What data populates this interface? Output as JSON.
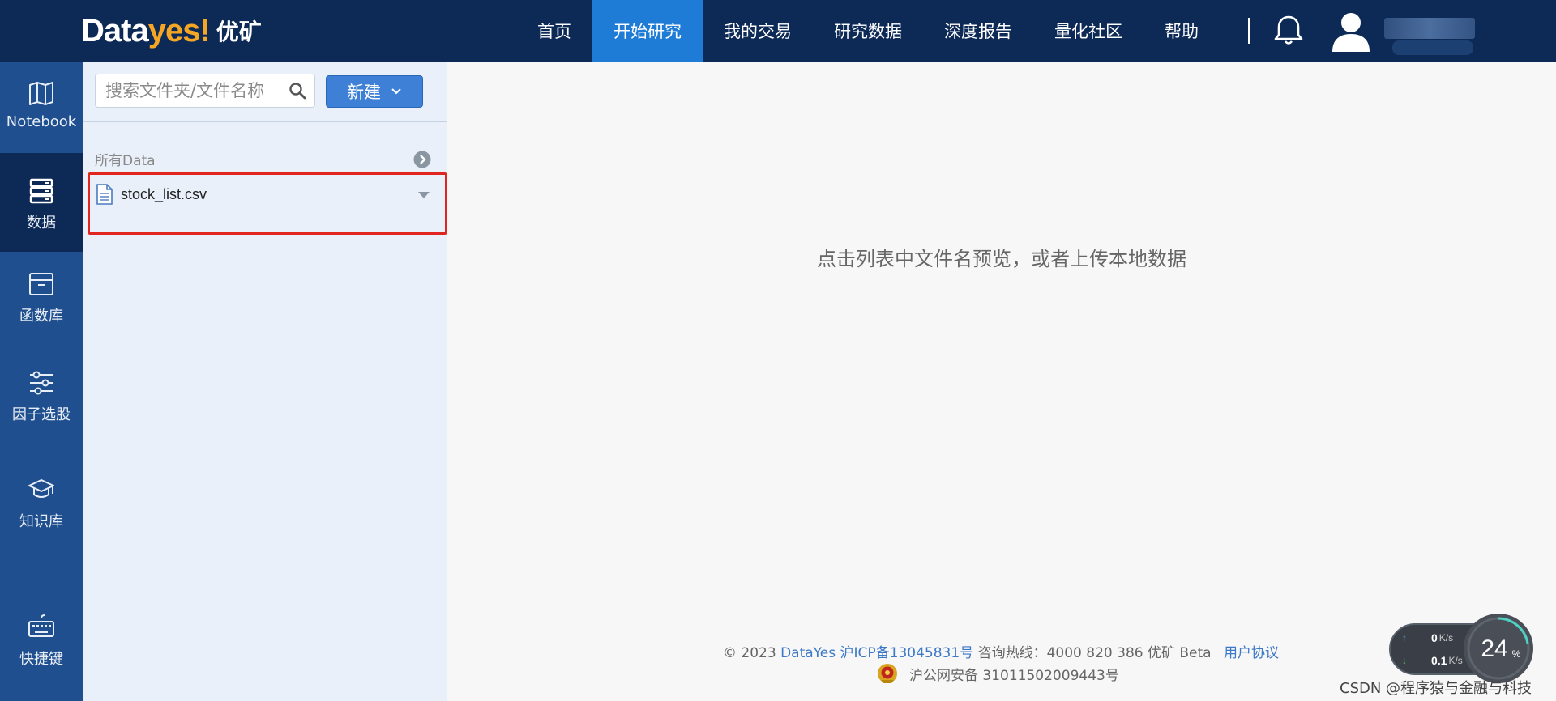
{
  "header": {
    "logo_main": "Data",
    "logo_accent": "yes!",
    "logo_cn": "优矿",
    "nav": [
      {
        "label": "首页"
      },
      {
        "label": "开始研究"
      },
      {
        "label": "我的交易"
      },
      {
        "label": "研究数据"
      },
      {
        "label": "深度报告"
      },
      {
        "label": "量化社区"
      },
      {
        "label": "帮助"
      }
    ],
    "active_nav": "开始研究",
    "icons": [
      "bell-icon",
      "avatar-icon"
    ]
  },
  "sidebar": {
    "items": [
      {
        "label": "Notebook",
        "icon": "book-icon"
      },
      {
        "label": "数据",
        "icon": "database-icon"
      },
      {
        "label": "函数库",
        "icon": "archive-icon"
      },
      {
        "label": "因子选股",
        "icon": "sliders-icon"
      },
      {
        "label": "知识库",
        "icon": "graduation-cap-icon"
      },
      {
        "label": "快捷键",
        "icon": "keyboard-icon"
      }
    ],
    "active": "数据"
  },
  "file_panel": {
    "search_placeholder": "搜索文件夹/文件名称",
    "new_button": "新建",
    "section_title": "所有Data",
    "files": [
      {
        "name": "stock_list.csv",
        "icon": "file-icon"
      }
    ]
  },
  "main": {
    "empty_hint": "点击列表中文件名预览，或者上传本地数据",
    "footer": {
      "copyright": "© 2023",
      "company_link": "DataYes",
      "icp_link": "沪ICP备13045831号",
      "hotline": "咨询热线：4000 820 386 优矿 Beta",
      "agreement_link": "用户协议",
      "police_record": "沪公网安备 31011502009443号"
    }
  },
  "net_widget": {
    "upload_value": "0",
    "upload_unit": "K/s",
    "download_value": "0.1",
    "download_unit": "K/s",
    "cpu_percent": "24",
    "percent_sign": "%"
  },
  "watermark": "CSDN @程序猿与金融与科技",
  "colors": {
    "topbar": "#0d2a57",
    "active_nav": "#1e7bd6",
    "sidebar": "#1f4f8e",
    "highlight_box": "#e0261f",
    "primary_button": "#3d80d6",
    "link": "#3c78c8"
  }
}
